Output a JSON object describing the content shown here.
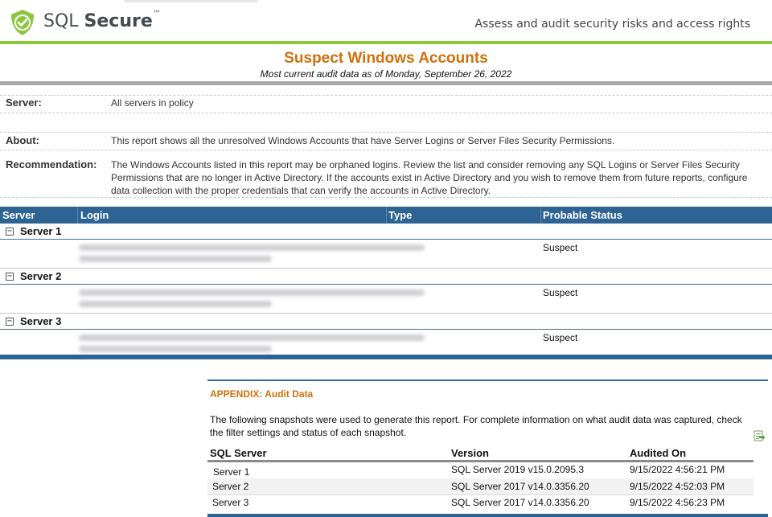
{
  "header": {
    "brand_regular": "SQL ",
    "brand_bold": "Secure",
    "brand_tm": "™",
    "tagline": "Assess and audit security risks and access rights"
  },
  "report": {
    "title": "Suspect Windows Accounts",
    "subtitle": "Most current audit data as of Monday, September 26, 2022"
  },
  "info": {
    "server_label": "Server:",
    "server_value": "All servers in policy",
    "about_label": "About:",
    "about_value": "This report shows all the unresolved Windows Accounts that have Server Logins or Server Files Security Permissions.",
    "recommendation_label": "Recommendation:",
    "recommendation_value": "The Windows Accounts listed in this report may be orphaned logins.  Review the list and consider removing any SQL Logins or Server Files Security Permissions that are no longer in Active Directory. If the accounts exist in Active Directory and you wish to remove them from future reports, configure data collection with the proper credentials that can verify the accounts in Active Directory."
  },
  "table": {
    "columns": [
      "Server",
      "Login",
      "Type",
      "Probable Status"
    ],
    "groups": [
      {
        "expander": "−",
        "name": "Server 1",
        "status": "Suspect"
      },
      {
        "expander": "−",
        "name": "Server 2",
        "status": "Suspect"
      },
      {
        "expander": "−",
        "name": "Server 3",
        "status": "Suspect"
      }
    ]
  },
  "appendix": {
    "title": "APPENDIX:  Audit Data",
    "text": "The following snapshots were used to generate this report. For complete information on what audit data was captured, check the filter settings and status of each snapshot.",
    "columns": [
      "SQL Server",
      "Version",
      "Audited On"
    ],
    "rows": [
      {
        "server": "Server 1",
        "version": "SQL Server 2019 v15.0.2095.3",
        "audited": "9/15/2022 4:56:21 PM"
      },
      {
        "server": "Server 2",
        "version": "SQL Server 2017 v14.0.3356.20",
        "audited": "9/15/2022 4:52:03 PM"
      },
      {
        "server": "Server 3",
        "version": "SQL Server 2017 v14.0.3356.20",
        "audited": "9/15/2022 4:56:23 PM"
      }
    ]
  },
  "colors": {
    "accent_orange": "#d0700b",
    "header_blue": "#2e6494",
    "brand_green": "#8cc63f"
  },
  "icons": {
    "logo": "shield-check-icon",
    "export": "export-excel-icon",
    "expander": "collapse-minus-icon"
  }
}
